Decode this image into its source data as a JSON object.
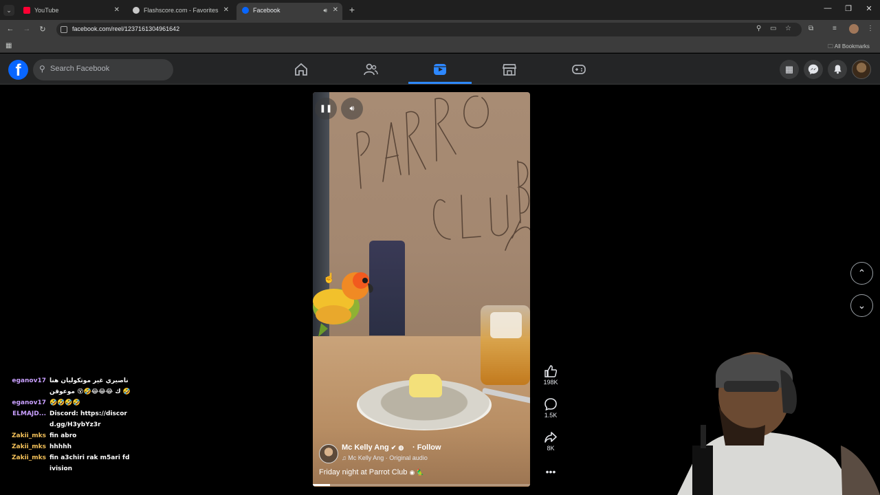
{
  "browser": {
    "tabs": [
      {
        "title": "YouTube",
        "active": false,
        "favicon_color": "#ff0033"
      },
      {
        "title": "Flashscore.com - Favorites",
        "active": false,
        "favicon_color": "#c8c8c8"
      },
      {
        "title": "Facebook",
        "active": true,
        "favicon_color": "#0866ff"
      }
    ],
    "url": "facebook.com/reel/1237161304961642",
    "bookmarks_label": "All Bookmarks"
  },
  "fb": {
    "logo": "f",
    "search_placeholder": "Search Facebook",
    "nav": [
      "home-icon",
      "friends-icon",
      "reels-icon",
      "marketplace-icon",
      "gaming-icon"
    ],
    "active_nav": "reels-icon",
    "accent": "#2d88ff"
  },
  "reel": {
    "author": "Mc Kelly Ang",
    "follow_label": "Follow",
    "audio": "Mc Kelly Ang · Original audio",
    "caption": "Friday night at Parrot Club",
    "progress": 0.08,
    "likes": "198K",
    "comments": "1.5K",
    "shares": "8K"
  },
  "chat": [
    {
      "user": "eganov17",
      "color": "#c9a0ff",
      "message": "ناصيري غير موتكوليان هناك 😂😂😂🤣😵 موعوقن 🤣"
    },
    {
      "user": "eganov17",
      "color": "#c9a0ff",
      "message": "🤣🤣🤣🤣"
    },
    {
      "user": "ELMAJD...",
      "color": "#c9a0ff",
      "message": "Discord: https://discord.gg/H3ybYz3r"
    },
    {
      "user": "Zakii_mks",
      "color": "#f5c25a",
      "message": "fin abro"
    },
    {
      "user": "Zakii_mks",
      "color": "#f5c25a",
      "message": "hhhhh"
    },
    {
      "user": "Zakii_mks",
      "color": "#f5c25a",
      "message": "fin a3chiri rak m5ari fdivision"
    }
  ]
}
